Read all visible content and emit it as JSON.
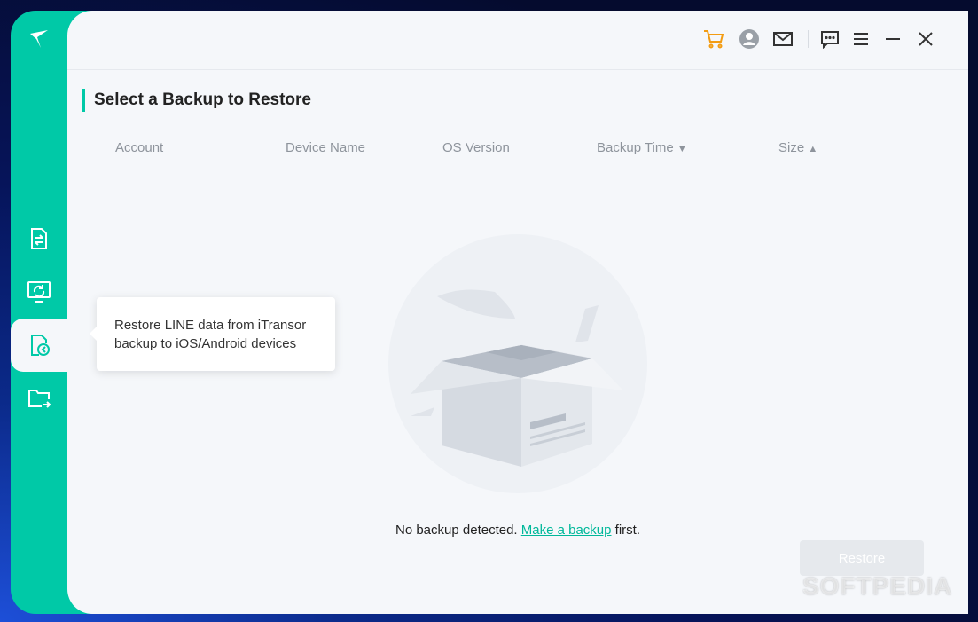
{
  "header": {
    "icons": [
      "cart-icon",
      "user-icon",
      "mail-icon",
      "feedback-icon",
      "menu-icon",
      "minimize-icon",
      "close-icon"
    ],
    "accent": "#00c9a7",
    "cart_color": "#f39c12"
  },
  "sidebar": {
    "items": [
      {
        "name": "transfer-icon"
      },
      {
        "name": "backup-icon"
      },
      {
        "name": "restore-icon",
        "active": true
      },
      {
        "name": "export-icon"
      }
    ]
  },
  "main": {
    "title": "Select a Backup to Restore",
    "columns": [
      "Account",
      "Device Name",
      "OS Version",
      "Backup Time",
      "Size"
    ],
    "sort_down": "▼",
    "sort_up": "▲",
    "empty_prefix": "No backup detected. ",
    "empty_link": "Make a backup",
    "empty_suffix": " first.",
    "restore_label": "Restore"
  },
  "tooltip": {
    "line1": "Restore LINE data from iTransor",
    "line2": "backup to iOS/Android devices"
  },
  "watermark": "SOFTPEDIA"
}
